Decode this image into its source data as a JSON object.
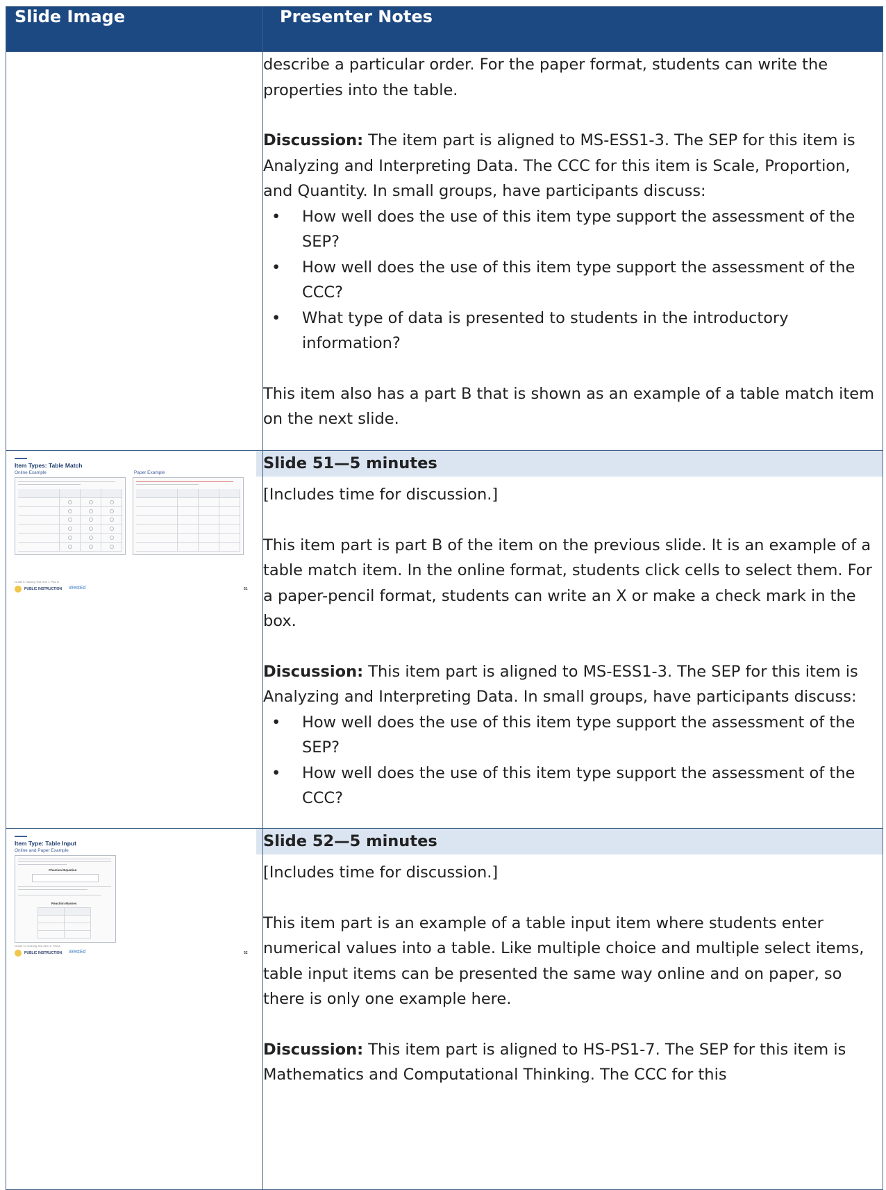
{
  "header": {
    "col1": "Slide Image",
    "col2": "Presenter Notes"
  },
  "row1": {
    "p1": "describe a particular order. For the paper format, students can write the properties into the table.",
    "discussion_label": "Discussion:",
    "discussion_text": " The item part is aligned to MS-ESS1-3. The SEP for this item is Analyzing and Interpreting Data. The CCC for this item is Scale, Proportion, and Quantity. In small groups, have participants discuss:",
    "bullets": [
      "How well does the use of this item type support the assessment of the SEP?",
      "How well does the use of this item type support the assessment of the CCC?",
      "What type of data is presented to students in the introductory information?"
    ],
    "p_end": "This item also has a part B that is shown as an example of a table match item on the next slide."
  },
  "row2": {
    "heading": "Slide 51—5 minutes",
    "p1": "[Includes time for discussion.]",
    "p2": "This item part is part B of the item on the previous slide. It is an example of a table match item. In the online format, students click cells to select them. For a paper-pencil format, students can write an X or make a check mark in the box.",
    "discussion_label": "Discussion:",
    "discussion_text": " This item part is aligned to MS-ESS1-3. The SEP for this item is Analyzing and Interpreting Data. In small groups, have participants discuss:",
    "bullets": [
      "How well does the use of this item type support the assessment of the SEP?",
      "How well does the use of this item type support the assessment of the CCC?"
    ],
    "thumb": {
      "title": "Item Types: Table Match",
      "left_label": "Online Example",
      "right_label": "Paper Example",
      "footer": "Grade 8 Training Test Item 1: Part B",
      "logo_line1": "PUBLIC INSTRUCTION",
      "logo_brand": "WestEd",
      "page": "51"
    }
  },
  "row3": {
    "heading": "Slide 52—5 minutes",
    "p1": "[Includes time for discussion.]",
    "p2": "This item part is an example of a table input item where students enter numerical values into a table. Like multiple choice and multiple select items, table input items can be presented the same way online and on paper, so there is only one example here.",
    "discussion_label": "Discussion:",
    "discussion_text": " This item part is aligned to HS-PS1-7. The SEP for this item is Mathematics and Computational Thinking. The CCC for this",
    "thumb": {
      "title": "Item Type: Table Input",
      "sub_label": "Online and Paper Example",
      "eq_label": "Chemical Equation",
      "table_label": "Reaction Masses",
      "footer": "Grade 10 Training Test Item 4: Part A",
      "logo_line1": "PUBLIC INSTRUCTION",
      "logo_brand": "WestEd",
      "page": "52"
    }
  }
}
